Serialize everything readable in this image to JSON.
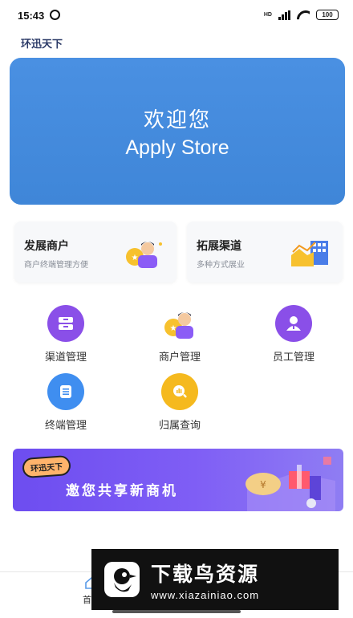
{
  "status": {
    "time": "15:43",
    "network": "HD",
    "battery": "100"
  },
  "app_title": "环迅天下",
  "banner": {
    "line1": "欢迎您",
    "line2": "Apply Store",
    "color": "#4a90e2"
  },
  "cards": [
    {
      "title": "发展商户",
      "subtitle": "商户终端管理方便"
    },
    {
      "title": "拓展渠道",
      "subtitle": "多种方式展业"
    }
  ],
  "grid": [
    {
      "label": "渠道管理",
      "icon": "drawer-icon",
      "color": "#8a4fe8"
    },
    {
      "label": "商户管理",
      "icon": "merchant-icon",
      "color": "#f5b91e"
    },
    {
      "label": "员工管理",
      "icon": "employee-icon",
      "color": "#8a4fe8"
    },
    {
      "label": "终端管理",
      "icon": "terminal-icon",
      "color": "#3f8ef0"
    },
    {
      "label": "归属查询",
      "icon": "query-icon",
      "color": "#f5b91e"
    }
  ],
  "promo": {
    "tag": "环迅天下",
    "text": "邀您共享新商机"
  },
  "tabbar": {
    "home_label": "首页"
  },
  "watermark": {
    "title": "下载鸟资源",
    "url": "www.xiazainiao.com"
  }
}
